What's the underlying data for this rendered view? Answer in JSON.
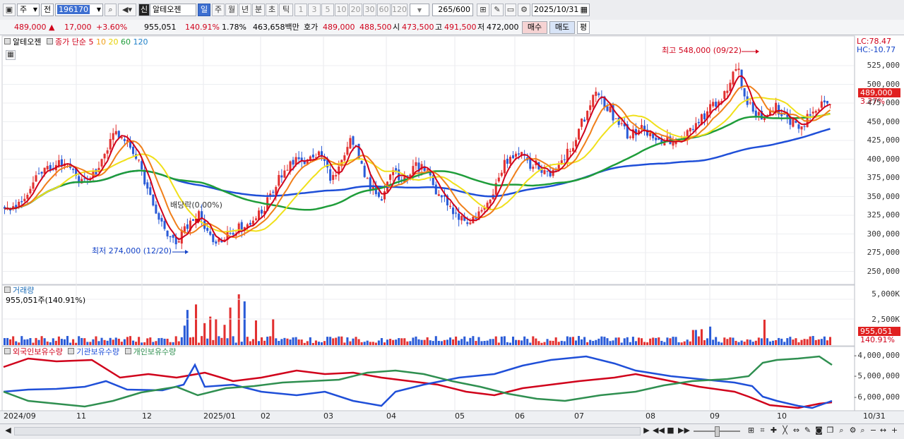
{
  "toolbar": {
    "type_code": "주",
    "range_code": "전",
    "stock_code": "196170",
    "credit_badge": "신",
    "stock_name": "알테오젠",
    "period_buttons": [
      "일",
      "주",
      "월",
      "년",
      "분",
      "초",
      "틱"
    ],
    "interval_buttons": [
      "1",
      "3",
      "5",
      "10",
      "20",
      "30",
      "60",
      "120"
    ],
    "count": "265",
    "count_max": "/600",
    "date": "2025/10/31"
  },
  "quote": {
    "price": "489,000",
    "change": "17,000",
    "change_pct": "+3.60%",
    "volume": "955,051",
    "volume_ratio": "140.91%",
    "turnover": "1.78%",
    "amount": "463,658백만",
    "ask_label": "호가",
    "ask": "489,000",
    "bid": "488,500",
    "open_label": "시",
    "open": "473,500",
    "high_label": "고",
    "high": "491,500",
    "low_label": "저",
    "low": "472,000",
    "buy": "매수",
    "sell": "매도",
    "eval": "평"
  },
  "price_panel": {
    "name": "알테오젠",
    "ma_label": "종가 단순",
    "ma_periods": [
      "5",
      "10",
      "20",
      "60",
      "120"
    ],
    "ma_colors": [
      "#d0021b",
      "#f07f1a",
      "#f0e01a",
      "#1f9d3a",
      "#1f4fd8"
    ],
    "lc": "LC:78.47",
    "hc": "HC:-10.77",
    "current": "489,000",
    "current_pct": "3.27%",
    "high_note": "최고 548,000 (09/22)",
    "low_note": "최저 274,000 (12/20)",
    "dividend_note": "배당락(0.00%)",
    "y_ticks": [
      "525,000",
      "500,000",
      "475,000",
      "450,000",
      "425,000",
      "400,000",
      "375,000",
      "350,000",
      "325,000",
      "300,000",
      "275,000",
      "250,000"
    ]
  },
  "volume_panel": {
    "title": "거래량",
    "value": "955,051주(140.91%)",
    "y_ticks": [
      "5,000K",
      "2,500K"
    ],
    "current": "955,051",
    "current_pct": "140.91%"
  },
  "holder_panel": {
    "series": [
      "외국인보유수량",
      "기관보유수량",
      "개인보유수량"
    ],
    "colors": [
      "#d0021b",
      "#1f4fd8",
      "#2f8f50"
    ],
    "y_ticks": [
      "-4,000,000",
      "-5,000,000",
      "-6,000,000"
    ]
  },
  "x_axis": {
    "labels": [
      "2024/09",
      "11",
      "12",
      "2025/01",
      "02",
      "03",
      "04",
      "05",
      "06",
      "07",
      "08",
      "09",
      "10"
    ],
    "right_label": "10/31"
  }
}
